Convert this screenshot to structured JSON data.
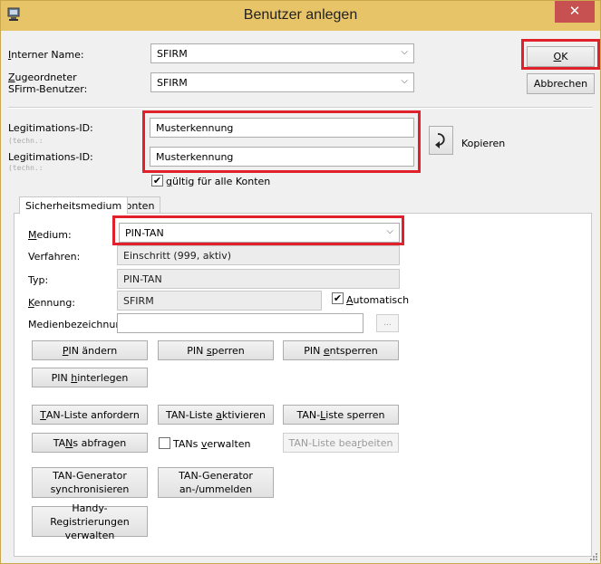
{
  "window": {
    "title": "Benutzer anlegen",
    "close_glyph": "✕"
  },
  "top": {
    "internal_name": {
      "label_first": "I",
      "label_rest": "nterner Name:",
      "value": "SFIRM"
    },
    "assigned_user": {
      "label_first": "Z",
      "label_line1_rest": "ugeordneter",
      "label_line2": "SFirm-Benutzer:",
      "value": "SFIRM"
    },
    "ok_label_first": "O",
    "ok_label_rest": "K",
    "cancel_label": "Abbrechen"
  },
  "legit": {
    "label1": "Legitimations-ID:",
    "hint1": "(techn.:",
    "value1": "Musterkennung",
    "label2": "Legitimations-ID:",
    "hint2": "(techn.:",
    "value2": "Musterkennung",
    "copy_label": "Kopieren",
    "all_accounts_first": "g",
    "all_accounts_rest": "ültig für alle Konten"
  },
  "tabs": [
    {
      "label": "Sicherheitsmedium"
    },
    {
      "label": "Konten"
    }
  ],
  "medium": {
    "medium_label_first": "M",
    "medium_label_rest": "edium:",
    "medium_value": "PIN-TAN",
    "verfahren_label": "Verfahren:",
    "verfahren_value": "Einschritt (999, aktiv)",
    "typ_label": "Typ:",
    "typ_value": "PIN-TAN",
    "kennung_label_first": "K",
    "kennung_label_rest": "ennung:",
    "kennung_value": "SFIRM",
    "auto_label_first": "A",
    "auto_label_rest": "utomatisch",
    "medienbez_label": "Medienbezeichnung:",
    "medienbez_value": "",
    "browse_label": "..."
  },
  "buttons": {
    "pin_aendern_pre": "",
    "pin_aendern_u": "P",
    "pin_aendern_post": "IN ändern",
    "pin_sperren_pre": "PIN ",
    "pin_sperren_u": "s",
    "pin_sperren_post": "perren",
    "pin_entsperren_pre": "PIN ",
    "pin_entsperren_u": "e",
    "pin_entsperren_post": "ntsperren",
    "pin_hinterlegen_pre": "PIN ",
    "pin_hinterlegen_u": "h",
    "pin_hinterlegen_post": "interlegen",
    "tan_anfordern_pre": "",
    "tan_anfordern_u": "T",
    "tan_anfordern_post": "AN-Liste anfordern",
    "tan_aktivieren_pre": "TAN-Liste ",
    "tan_aktivieren_u": "a",
    "tan_aktivieren_post": "ktivieren",
    "tan_sperren_pre": "TAN-",
    "tan_sperren_u": "L",
    "tan_sperren_post": "iste sperren",
    "tans_abfragen_pre": "TA",
    "tans_abfragen_u": "N",
    "tans_abfragen_post": "s abfragen",
    "tans_verwalten_pre": "TANs ",
    "tans_verwalten_u": "v",
    "tans_verwalten_post": "erwalten",
    "tan_bearbeiten_pre": "TAN-Liste bea",
    "tan_bearbeiten_u": "r",
    "tan_bearbeiten_post": "beiten",
    "tan_gen_sync_l1": "TAN-Generator",
    "tan_gen_sync_l2": "synchronisieren",
    "tan_gen_anm_l1": "TAN-Generator",
    "tan_gen_anm_l2": "an-/ummelden",
    "handy_l1": "Handy-Registrierungen",
    "handy_l2": "verwalten"
  },
  "colors": {
    "titlebar": "#e8c468",
    "close": "#c75050",
    "highlight": "#e0202a"
  }
}
